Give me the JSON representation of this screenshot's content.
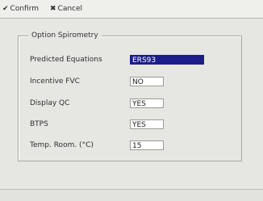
{
  "toolbar": {
    "confirm_label": "Confirm",
    "confirm_icon": "check-icon",
    "cancel_label": "Cancel",
    "cancel_icon": "cross-icon"
  },
  "panel": {
    "title": "Option Spirometry",
    "fields": [
      {
        "label": "Predicted Equations",
        "value": "ERS93"
      },
      {
        "label": "Incentive FVC",
        "value": "NO"
      },
      {
        "label": "Display QC",
        "value": "YES"
      },
      {
        "label": "BTPS",
        "value": "YES"
      },
      {
        "label": "Temp. Room. (°C)",
        "value": "15"
      }
    ]
  },
  "colors": {
    "selection": "#1d1d8a"
  }
}
